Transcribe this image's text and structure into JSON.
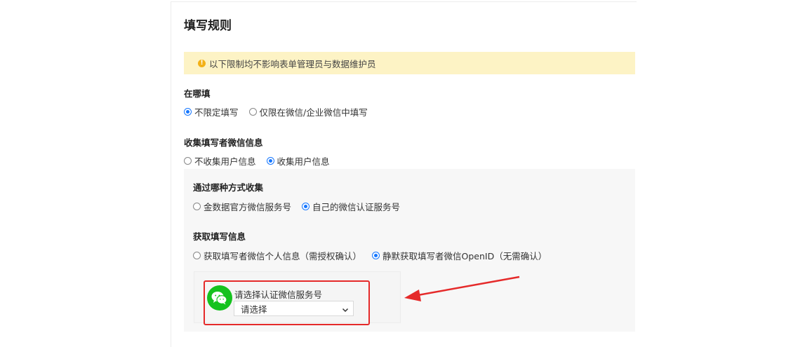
{
  "page": {
    "title": "填写规则",
    "notice": "以下限制均不影响表单管理员与数据维护员"
  },
  "where_fill": {
    "label": "在哪填",
    "options": [
      "不限定填写",
      "仅限在微信/企业微信中填写"
    ],
    "selected": 0
  },
  "collect_wechat": {
    "label": "收集填写者微信信息",
    "options": [
      "不收集用户信息",
      "收集用户信息"
    ],
    "selected": 1
  },
  "collect_method": {
    "label": "通过哪种方式收集",
    "options": [
      "金数据官方微信服务号",
      "自己的微信认证服务号"
    ],
    "selected": 1
  },
  "get_info": {
    "label": "获取填写信息",
    "options": [
      "获取填写者微信个人信息（需授权确认）",
      "静默获取填写者微信OpenID（无需确认）"
    ],
    "selected": 1
  },
  "service_account": {
    "label": "请选择认证微信服务号",
    "select_value": "请选择"
  },
  "colors": {
    "accent": "#1677ff",
    "highlight": "#e52a2a",
    "wechat": "#15c21f",
    "notice_bg": "#fdf3c5"
  },
  "icons": {
    "notice": "warning-circle-icon",
    "wechat": "wechat-icon",
    "select": "chevron-down-icon"
  }
}
